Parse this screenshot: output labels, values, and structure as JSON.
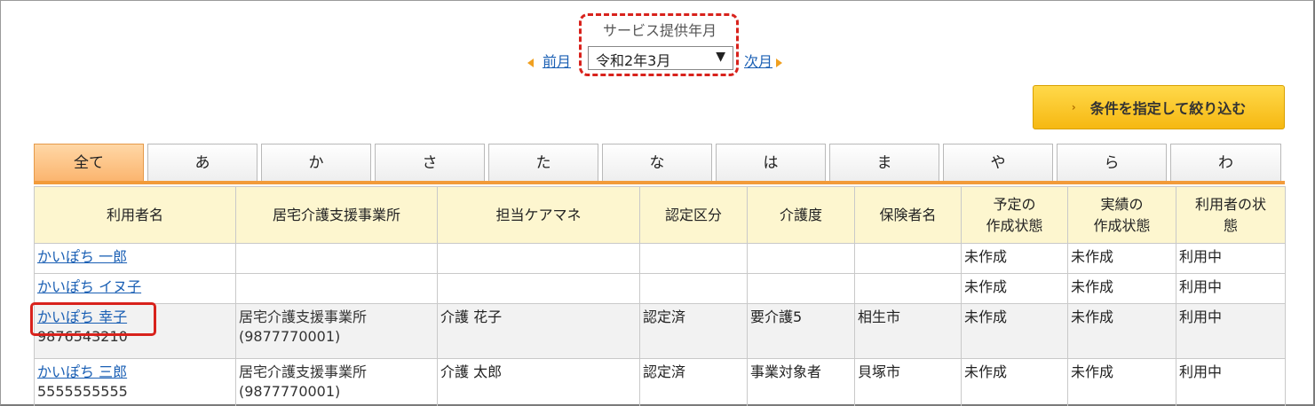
{
  "service_month": {
    "label": "サービス提供年月",
    "prev": "前月",
    "next": "次月",
    "selected": "令和2年3月",
    "caret": "▼"
  },
  "filter_button": {
    "label": "条件を指定して絞り込む",
    "chevron": "›"
  },
  "tabs": [
    "全て",
    "あ",
    "か",
    "さ",
    "た",
    "な",
    "は",
    "ま",
    "や",
    "ら",
    "わ"
  ],
  "active_tab": "全て",
  "table": {
    "headers": [
      "利用者名",
      "居宅介護支援事業所",
      "担当ケアマネ",
      "認定区分",
      "介護度",
      "保険者名",
      "予定の\n作成状態",
      "実績の\n作成状態",
      "利用者の状\n態"
    ],
    "rows": [
      {
        "name": "かいぽち 一郎",
        "number": "",
        "office": "",
        "office_no": "",
        "care_manager": "",
        "certification": "",
        "care_level": "",
        "insurer": "",
        "plan_status": "未作成",
        "actual_status": "未作成",
        "user_status": "利用中"
      },
      {
        "name": "かいぽち イヌ子",
        "number": "",
        "office": "",
        "office_no": "",
        "care_manager": "",
        "certification": "",
        "care_level": "",
        "insurer": "",
        "plan_status": "未作成",
        "actual_status": "未作成",
        "user_status": "利用中"
      },
      {
        "name": "かいぽち 幸子",
        "number": "9876543210",
        "office": "居宅介護支援事業所",
        "office_no": "(9877770001)",
        "care_manager": "介護 花子",
        "certification": "認定済",
        "care_level": "要介護5",
        "insurer": "相生市",
        "plan_status": "未作成",
        "actual_status": "未作成",
        "user_status": "利用中"
      },
      {
        "name": "かいぽち 三郎",
        "number": "5555555555",
        "office": "居宅介護支援事業所",
        "office_no": "(9877770001)",
        "care_manager": "介護 太郎",
        "certification": "認定済",
        "care_level": "事業対象者",
        "insurer": "貝塚市",
        "plan_status": "未作成",
        "actual_status": "未作成",
        "user_status": "利用中"
      }
    ]
  },
  "colors": {
    "annotation_red": "#d8221c",
    "tab_active": "#fbb56f",
    "header_bg": "#fdf6cf",
    "button_yellow": "#f6b812",
    "link_blue": "#1a5fb4"
  }
}
